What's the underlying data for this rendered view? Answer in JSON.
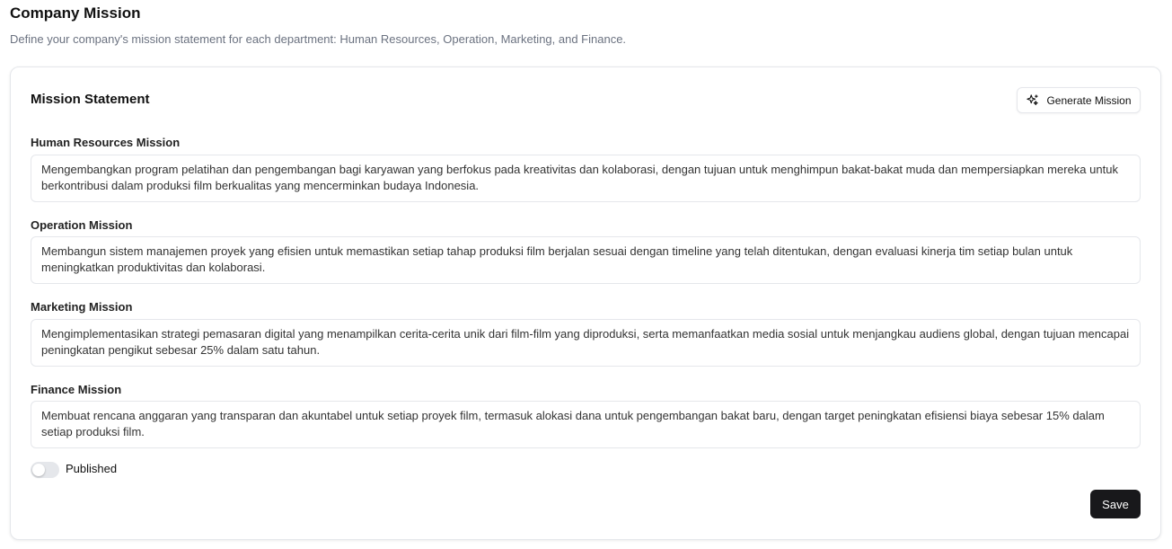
{
  "header": {
    "title": "Company Mission",
    "subtitle": "Define your company's mission statement for each department: Human Resources, Operation, Marketing, and Finance."
  },
  "card": {
    "title": "Mission Statement",
    "generate_label": "Generate Mission",
    "generate_icon": "sparkles-icon"
  },
  "fields": [
    {
      "label": "Human Resources Mission",
      "value": "Mengembangkan program pelatihan dan pengembangan bagi karyawan yang berfokus pada kreativitas dan kolaborasi, dengan tujuan untuk menghimpun bakat-bakat muda dan mempersiapkan mereka untuk berkontribusi dalam produksi film berkualitas yang mencerminkan budaya Indonesia."
    },
    {
      "label": "Operation Mission",
      "value": "Membangun sistem manajemen proyek yang efisien untuk memastikan setiap tahap produksi film berjalan sesuai dengan timeline yang telah ditentukan, dengan evaluasi kinerja tim setiap bulan untuk meningkatkan produktivitas dan kolaborasi."
    },
    {
      "label": "Marketing Mission",
      "value": "Mengimplementasikan strategi pemasaran digital yang menampilkan cerita-cerita unik dari film-film yang diproduksi, serta memanfaatkan media sosial untuk menjangkau audiens global, dengan tujuan mencapai peningkatan pengikut sebesar 25% dalam satu tahun."
    },
    {
      "label": "Finance Mission",
      "value": "Membuat rencana anggaran yang transparan dan akuntabel untuk setiap proyek film, termasuk alokasi dana untuk pengembangan bakat baru, dengan target peningkatan efisiensi biaya sebesar 15% dalam setiap produksi film."
    }
  ],
  "published": {
    "label": "Published",
    "checked": false
  },
  "save_label": "Save"
}
